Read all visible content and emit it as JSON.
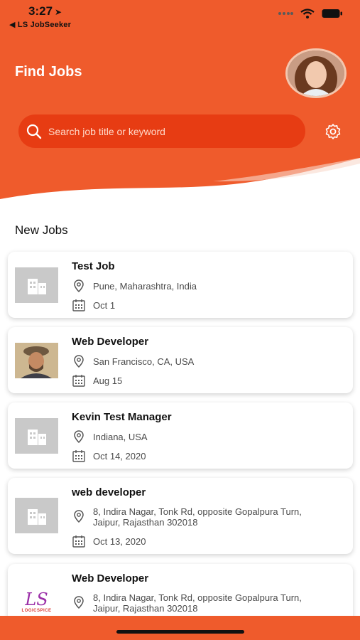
{
  "status_bar": {
    "time": "3:27",
    "back_label": "◀ LS JobSeeker"
  },
  "header": {
    "title": "Find Jobs"
  },
  "search": {
    "placeholder": "Search job title or keyword"
  },
  "section": {
    "title": "New Jobs"
  },
  "jobs": [
    {
      "title": "Test Job",
      "location": "Pune, Maharashtra, India",
      "date": "Oct 1",
      "thumb": "building-placeholder"
    },
    {
      "title": "Web Developer",
      "location": "San Francisco, CA, USA",
      "date": "Aug 15",
      "thumb": "person-photo"
    },
    {
      "title": "Kevin Test Manager",
      "location": "Indiana, USA",
      "date": "Oct 14, 2020",
      "thumb": "building-placeholder"
    },
    {
      "title": "web developer",
      "location": "8, Indira Nagar, Tonk Rd, opposite Gopalpura Turn, Jaipur, Rajasthan 302018",
      "date": "Oct 13, 2020",
      "thumb": "building-placeholder"
    },
    {
      "title": "Web Developer",
      "location": "8, Indira Nagar, Tonk Rd, opposite Gopalpura Turn, Jaipur, Rajasthan 302018",
      "date": "",
      "thumb": "company-logo",
      "logo_text": "LS",
      "logo_subtext": "LOGICSPICE"
    }
  ],
  "colors": {
    "accent": "#ef5b2c",
    "search_bg": "#e73c13"
  }
}
